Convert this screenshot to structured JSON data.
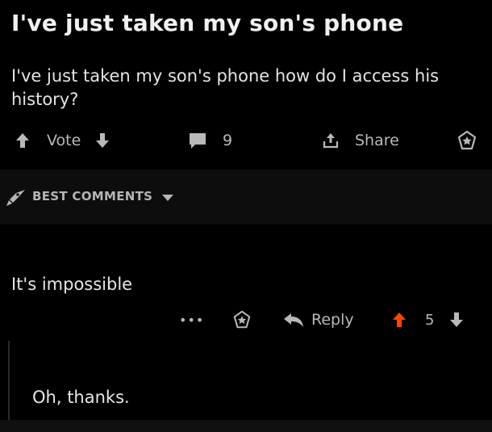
{
  "post": {
    "title": "I've just taken my son's phone",
    "body": "I've just taken my son's phone how do I access his history?",
    "vote_label": "Vote",
    "comment_count": "9",
    "share_label": "Share"
  },
  "sort": {
    "label": "BEST COMMENTS"
  },
  "comment": {
    "text": "It's impossible",
    "more_label": "•••",
    "reply_label": "Reply",
    "score": "5"
  },
  "reply": {
    "text": "Oh, thanks."
  },
  "colors": {
    "background": "#000000",
    "upvote_active": "#ff4500",
    "icon_gray": "#b9b9b9",
    "sort_bar": "#0d0d0d"
  },
  "icons": [
    "upvote-icon",
    "downvote-icon",
    "comment-icon",
    "share-icon",
    "bookmark-icon",
    "rocket-icon",
    "chevron-down-icon",
    "reply-icon"
  ]
}
